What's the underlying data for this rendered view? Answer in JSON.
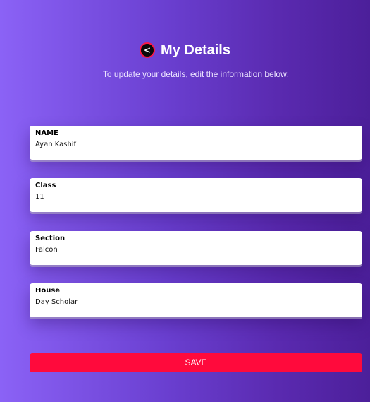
{
  "header": {
    "back_glyph": "<",
    "title": "My Details",
    "subtitle": "To update your details, edit the information below:"
  },
  "fields": [
    {
      "label": "NAME",
      "value": "Ayan Kashif"
    },
    {
      "label": "Class",
      "value": "11"
    },
    {
      "label": "Section",
      "value": "Falcon"
    },
    {
      "label": "House",
      "value": "Day Scholar"
    }
  ],
  "actions": {
    "save_label": "SAVE"
  },
  "colors": {
    "accent": "#ff0a3c",
    "background_start": "#8b62f6",
    "background_end": "#4c1f9a"
  },
  "icons": {
    "back": "back-arrow-icon"
  }
}
